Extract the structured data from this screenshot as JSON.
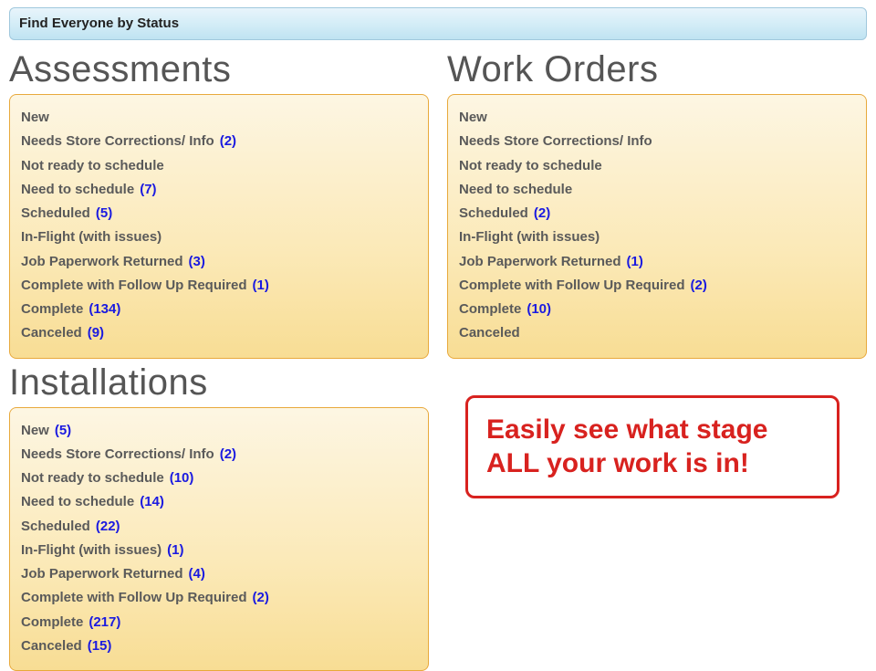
{
  "header": {
    "title": "Find Everyone by Status"
  },
  "sections": {
    "assessments": {
      "title": "Assessments",
      "items": [
        {
          "label": "New",
          "count": ""
        },
        {
          "label": "Needs Store Corrections/ Info",
          "count": "(2)"
        },
        {
          "label": "Not ready to schedule",
          "count": ""
        },
        {
          "label": "Need to schedule",
          "count": "(7)"
        },
        {
          "label": "Scheduled",
          "count": "(5)"
        },
        {
          "label": "In-Flight (with issues)",
          "count": ""
        },
        {
          "label": "Job Paperwork Returned ",
          "count": "(3)"
        },
        {
          "label": "Complete with Follow Up Required",
          "count": "(1)"
        },
        {
          "label": "Complete ",
          "count": "(134)"
        },
        {
          "label": "Canceled ",
          "count": "(9)"
        }
      ]
    },
    "workorders": {
      "title": "Work Orders",
      "items": [
        {
          "label": "New",
          "count": ""
        },
        {
          "label": "Needs Store Corrections/ Info",
          "count": ""
        },
        {
          "label": "Not ready to schedule",
          "count": ""
        },
        {
          "label": "Need to schedule",
          "count": ""
        },
        {
          "label": "Scheduled ",
          "count": "(2)"
        },
        {
          "label": "In-Flight (with issues)",
          "count": ""
        },
        {
          "label": "Job Paperwork Returned",
          "count": "(1)"
        },
        {
          "label": "Complete with Follow Up Required",
          "count": "(2)"
        },
        {
          "label": "Complete ",
          "count": "(10)"
        },
        {
          "label": "Canceled",
          "count": ""
        }
      ]
    },
    "installations": {
      "title": "Installations",
      "items": [
        {
          "label": "New ",
          "count": "(5)"
        },
        {
          "label": "Needs Store Corrections/ Info",
          "count": "(2)"
        },
        {
          "label": "Not ready to schedule",
          "count": "(10)"
        },
        {
          "label": "Need to schedule",
          "count": "(14)"
        },
        {
          "label": "Scheduled ",
          "count": "(22)"
        },
        {
          "label": "In-Flight (with issues) ",
          "count": "(1)"
        },
        {
          "label": "Job Paperwork Returned ",
          "count": "(4)"
        },
        {
          "label": "Complete with Follow Up Required",
          "count": "(2)"
        },
        {
          "label": "Complete ",
          "count": "(217)"
        },
        {
          "label": "Canceled ",
          "count": "(15)"
        }
      ]
    }
  },
  "callout": {
    "line1": "Easily see what stage",
    "line2": "ALL your work is in!"
  }
}
